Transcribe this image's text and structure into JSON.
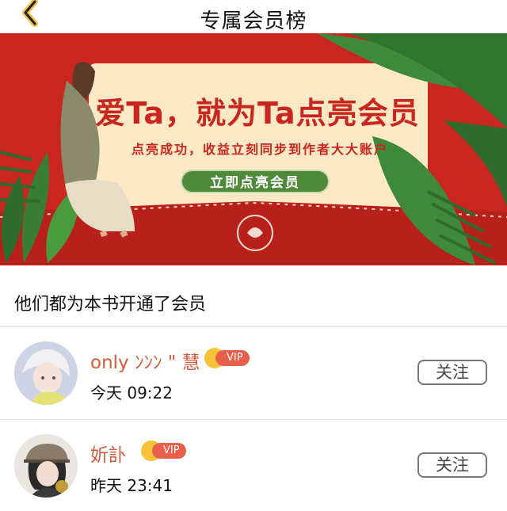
{
  "header": {
    "title": "专属会员榜"
  },
  "banner": {
    "headline": "爱Ta，就为Ta点亮会员",
    "subtitle": "点亮成功，收益立刻同步到作者大大账户",
    "cta_label": "立即点亮会员"
  },
  "section": {
    "title": "他们都为本书开通了会员"
  },
  "members": [
    {
      "name": "only ﾝﾝﾝ \" 慧",
      "vip": "VIP",
      "time": "今天 09:22",
      "follow_label": "关注",
      "avatar": "avatar-white-hair-girl"
    },
    {
      "name": "妡訃",
      "vip": "VIP",
      "time": "昨天 23:41",
      "follow_label": "关注",
      "avatar": "avatar-girl-with-cap"
    }
  ],
  "colors": {
    "banner_red": "#c8261f",
    "cream": "#fbe9c6",
    "leaf_green": "#4e8a3a",
    "name_color": "#d55a3c",
    "vip_tag": "#e8604b"
  }
}
